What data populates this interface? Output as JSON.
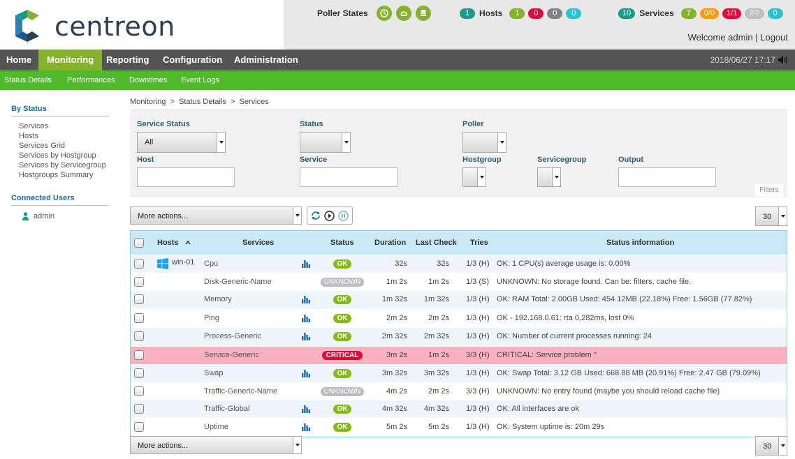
{
  "brand": {
    "name": "centreon"
  },
  "header": {
    "poller_label": "Poller States",
    "hosts_label": "Hosts",
    "hosts_counts": {
      "total": "1",
      "up": "1",
      "down": "0",
      "unreachable": "0",
      "pending": "0"
    },
    "services_label": "Services",
    "services_counts": {
      "total": "10",
      "ok": "7",
      "warning": "0/0",
      "critical": "1/1",
      "unknown": "2/2",
      "pending": "0"
    },
    "welcome": "Welcome admin",
    "separator": "|",
    "logout": "Logout"
  },
  "mainnav": {
    "items": [
      "Home",
      "Monitoring",
      "Reporting",
      "Configuration",
      "Administration"
    ],
    "datetime": "2018/06/27 17:17"
  },
  "subnav": {
    "items": [
      "Status  Details",
      "Performances",
      "Downtimes",
      "Event  Logs"
    ]
  },
  "sidebar": {
    "by_status_title": "By Status",
    "links": [
      "Services",
      "Hosts",
      "Services Grid",
      "Services by Hostgroup",
      "Services by Servicegroup",
      "Hostgroups Summary"
    ],
    "connected_title": "Connected Users",
    "user": "admin"
  },
  "breadcrumb": "Monitoring  >  Status Details  >  Services",
  "filters": {
    "service_status_label": "Service Status",
    "service_status_value": "All",
    "status_label": "Status",
    "poller_label": "Poller",
    "host_label": "Host",
    "service_label": "Service",
    "hostgroup_label": "Hostgroup",
    "servicegroup_label": "Servicegroup",
    "output_label": "Output",
    "tab": "Filters"
  },
  "toolbar": {
    "more_actions": "More actions...",
    "page_size": "30"
  },
  "table": {
    "headers": {
      "hosts": "Hosts",
      "services": "Services",
      "status": "Status",
      "duration": "Duration",
      "last_check": "Last Check",
      "tries": "Tries",
      "info": "Status information"
    },
    "host": "win-01",
    "rows": [
      {
        "service": "Cpu",
        "status": "OK",
        "duration": "32s",
        "last_check": "32s",
        "tries": "1/3 (H)",
        "info": "OK: 1 CPU(s) average usage is: 0.00%"
      },
      {
        "service": "Disk-Generic-Name",
        "status": "UNKNOWN",
        "duration": "1m 2s",
        "last_check": "1m 2s",
        "tries": "1/3 (S)",
        "info": "UNKNOWN: No storage found. Can be: filters, cache file."
      },
      {
        "service": "Memory",
        "status": "OK",
        "duration": "1m 32s",
        "last_check": "1m 32s",
        "tries": "1/3 (H)",
        "info": "OK: RAM Total: 2.00GB Used: 454.12MB (22.18%) Free: 1.56GB (77.82%)"
      },
      {
        "service": "Ping",
        "status": "OK",
        "duration": "2m 2s",
        "last_check": "2m 2s",
        "tries": "1/3 (H)",
        "info": "OK - 192.168.0.61: rta 0,282ms, lost 0%"
      },
      {
        "service": "Process-Generic",
        "status": "OK",
        "duration": "2m 32s",
        "last_check": "2m 32s",
        "tries": "1/3 (H)",
        "info": "OK: Number of current processes running: 24"
      },
      {
        "service": "Service-Generic",
        "status": "CRITICAL",
        "duration": "3m 2s",
        "last_check": "1m 2s",
        "tries": "3/3 (H)",
        "info": "CRITICAL: Service problem ''"
      },
      {
        "service": "Swap",
        "status": "OK",
        "duration": "3m 32s",
        "last_check": "3m 32s",
        "tries": "1/3 (H)",
        "info": "OK: Swap Total: 3.12 GB Used: 668.88 MB (20.91%) Free: 2.47 GB (79.09%)"
      },
      {
        "service": "Traffic-Generic-Name",
        "status": "UNKNOWN",
        "duration": "4m 2s",
        "last_check": "2m 2s",
        "tries": "3/3 (H)",
        "info": "UNKNOWN: No entry found (maybe you should reload cache file)"
      },
      {
        "service": "Traffic-Global",
        "status": "OK",
        "duration": "4m 32s",
        "last_check": "4m 32s",
        "tries": "1/3 (H)",
        "info": "OK: All interfaces are ok"
      },
      {
        "service": "Uptime",
        "status": "OK",
        "duration": "5m 2s",
        "last_check": "5m 2s",
        "tries": "1/3 (H)",
        "info": "OK: System uptime is: 20m 29s"
      }
    ]
  },
  "colors": {
    "brand_green": "#84b32b",
    "subnav_green": "#4fbb2a",
    "critical": "#e00b3d",
    "ok": "#88b917",
    "unknown": "#bcbdc0"
  }
}
